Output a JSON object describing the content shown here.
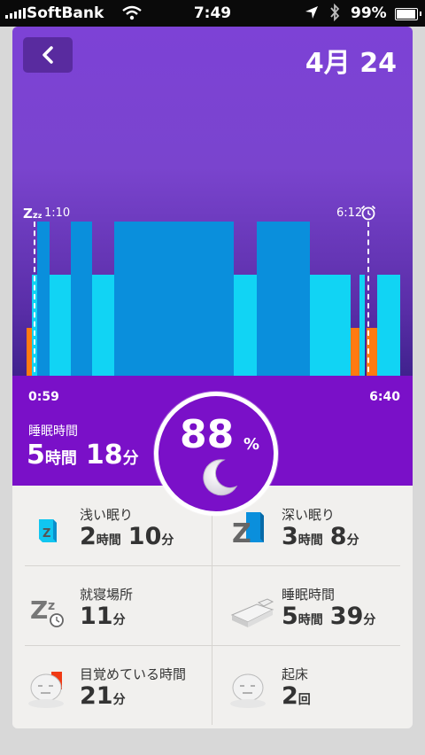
{
  "status_bar": {
    "carrier": "SoftBank",
    "time": "7:49",
    "battery": "99%"
  },
  "header": {
    "back_icon": "chevron-left-icon",
    "date": "4月 24"
  },
  "chart": {
    "start_marker": "1:10",
    "end_marker": "6:12",
    "range_start": "0:59",
    "range_end": "6:40",
    "colors": {
      "deep": "#0a8fdc",
      "light": "#11d4f4",
      "awake": "#ff7a10"
    },
    "legend_icons": [
      "zzz-icon",
      "alarm-clock-icon"
    ]
  },
  "summary": {
    "label": "睡眠時間",
    "hours": "5",
    "hours_unit": "時間",
    "minutes": "18",
    "minutes_unit": "分",
    "score": "88",
    "score_unit": "%",
    "score_icon": "moon-icon"
  },
  "stats": [
    {
      "label": "浅い眠り",
      "h": "2",
      "h_unit": "時間",
      "m": "10",
      "m_unit": "分",
      "icon": "light-sleep-icon"
    },
    {
      "label": "深い眠り",
      "h": "3",
      "h_unit": "時間",
      "m": "8",
      "m_unit": "分",
      "icon": "deep-sleep-icon"
    },
    {
      "label": "就寝場所",
      "h": "11",
      "h_unit": "分",
      "icon": "fall-asleep-icon"
    },
    {
      "label": "睡眠時間",
      "h": "5",
      "h_unit": "時間",
      "m": "39",
      "m_unit": "分",
      "icon": "bed-icon"
    },
    {
      "label": "目覚めている時間",
      "h": "21",
      "h_unit": "分",
      "icon": "awake-face-icon"
    },
    {
      "label": "起床",
      "h": "2",
      "h_unit": "回",
      "icon": "wake-up-face-icon"
    }
  ]
}
